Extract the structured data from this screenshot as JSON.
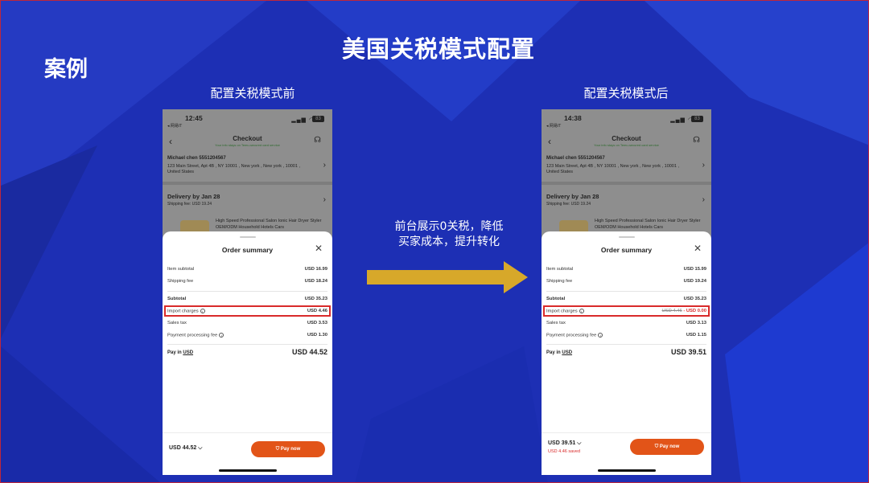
{
  "slide": {
    "title": "美国关税模式配置",
    "case_label": "案例",
    "before_caption": "配置关税模式前",
    "after_caption": "配置关税模式后",
    "arrow_text_line1": "前台展示0关税，降低",
    "arrow_text_line2": "买家成本，提升转化",
    "colors": {
      "background": "#1d2fb4",
      "arrow": "#d7a82a",
      "highlight": "#d92b2b",
      "pay_button": "#e25418"
    }
  },
  "before": {
    "status_time": "12:45",
    "back_app": "◂ 网易IT",
    "battery": "83",
    "checkout_title": "Checkout",
    "checkout_sub": "Your info stays on Temu-secured card service",
    "addr_name": "Michael chen   5551204567",
    "addr_line": "123 Main Street, Apt 4B , NY 10001 , New york , New york , 10001 , United States",
    "delivery": "Delivery by Jan 28",
    "ship_fee": "Shipping fee: USD 19.24",
    "product_name": "High Speed Professional Salon Ionic Hair Dryer Styler OEM/ODM Household Hotels Cars",
    "sheet_title": "Order summary",
    "rows": {
      "item_subtotal": {
        "label": "Item subtotal",
        "value": "USD 16.99"
      },
      "shipping_fee": {
        "label": "Shipping fee",
        "value": "USD 18.24"
      },
      "subtotal": {
        "label": "Subtotal",
        "value": "USD 35.23"
      },
      "import_charges": {
        "label": "Import charges",
        "value": "USD 4.46"
      },
      "sales_tax": {
        "label": "Sales tax",
        "value": "USD 3.53"
      },
      "payment_fee": {
        "label": "Payment processing fee",
        "value": "USD 1.30"
      }
    },
    "pay_in_label": "Pay in",
    "pay_in_currency": "USD",
    "pay_total": "USD 44.52",
    "bottom_total": "USD 44.52 ⌵",
    "pay_now": "Pay now"
  },
  "after": {
    "status_time": "14:38",
    "back_app": "◂ 网易IT",
    "battery": "83",
    "checkout_title": "Checkout",
    "checkout_sub": "Your info stays on Temu-secured card service",
    "addr_name": "Michael chen   5551204567",
    "addr_line": "123 Main Street, Apt 4B , NY 10001 , New york , New york , 10001 , United States",
    "delivery": "Delivery by Jan 28",
    "ship_fee": "Shipping fee: USD 19.24",
    "product_name": "High Speed Professional Salon Ionic Hair Dryer Styler OEM/ODM Household Hotels Cars",
    "sheet_title": "Order summary",
    "rows": {
      "item_subtotal": {
        "label": "Item subtotal",
        "value": "USD 15.99"
      },
      "shipping_fee": {
        "label": "Shipping fee",
        "value": "USD 19.24"
      },
      "subtotal": {
        "label": "Subtotal",
        "value": "USD 35.23"
      },
      "import_charges": {
        "label": "Import charges",
        "old_value": "USD 4.46",
        "value": "- USD 0.00"
      },
      "sales_tax": {
        "label": "Sales tax",
        "value": "USD 3.13"
      },
      "payment_fee": {
        "label": "Payment processing fee",
        "value": "USD 1.15"
      }
    },
    "pay_in_label": "Pay in",
    "pay_in_currency": "USD",
    "pay_total": "USD 39.51",
    "bottom_total": "USD 39.51 ⌵",
    "saved": "USD 4.46 saved",
    "pay_now": "Pay now"
  }
}
